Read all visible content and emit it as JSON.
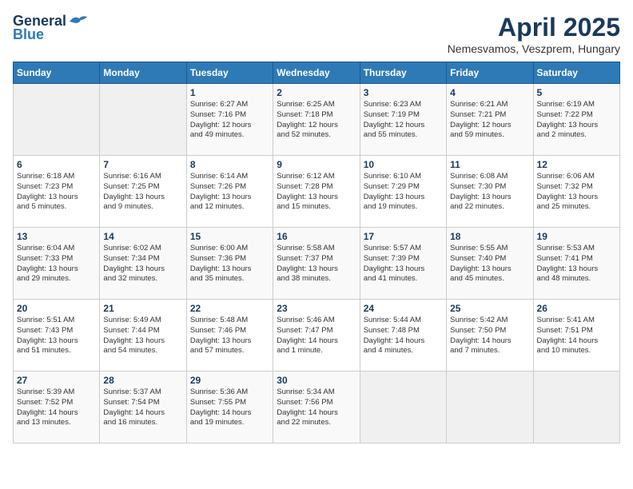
{
  "logo": {
    "general": "General",
    "blue": "Blue"
  },
  "title": "April 2025",
  "location": "Nemesvamos, Veszprem, Hungary",
  "days_header": [
    "Sunday",
    "Monday",
    "Tuesday",
    "Wednesday",
    "Thursday",
    "Friday",
    "Saturday"
  ],
  "weeks": [
    [
      {
        "num": "",
        "info": ""
      },
      {
        "num": "",
        "info": ""
      },
      {
        "num": "1",
        "info": "Sunrise: 6:27 AM\nSunset: 7:16 PM\nDaylight: 12 hours\nand 49 minutes."
      },
      {
        "num": "2",
        "info": "Sunrise: 6:25 AM\nSunset: 7:18 PM\nDaylight: 12 hours\nand 52 minutes."
      },
      {
        "num": "3",
        "info": "Sunrise: 6:23 AM\nSunset: 7:19 PM\nDaylight: 12 hours\nand 55 minutes."
      },
      {
        "num": "4",
        "info": "Sunrise: 6:21 AM\nSunset: 7:21 PM\nDaylight: 12 hours\nand 59 minutes."
      },
      {
        "num": "5",
        "info": "Sunrise: 6:19 AM\nSunset: 7:22 PM\nDaylight: 13 hours\nand 2 minutes."
      }
    ],
    [
      {
        "num": "6",
        "info": "Sunrise: 6:18 AM\nSunset: 7:23 PM\nDaylight: 13 hours\nand 5 minutes."
      },
      {
        "num": "7",
        "info": "Sunrise: 6:16 AM\nSunset: 7:25 PM\nDaylight: 13 hours\nand 9 minutes."
      },
      {
        "num": "8",
        "info": "Sunrise: 6:14 AM\nSunset: 7:26 PM\nDaylight: 13 hours\nand 12 minutes."
      },
      {
        "num": "9",
        "info": "Sunrise: 6:12 AM\nSunset: 7:28 PM\nDaylight: 13 hours\nand 15 minutes."
      },
      {
        "num": "10",
        "info": "Sunrise: 6:10 AM\nSunset: 7:29 PM\nDaylight: 13 hours\nand 19 minutes."
      },
      {
        "num": "11",
        "info": "Sunrise: 6:08 AM\nSunset: 7:30 PM\nDaylight: 13 hours\nand 22 minutes."
      },
      {
        "num": "12",
        "info": "Sunrise: 6:06 AM\nSunset: 7:32 PM\nDaylight: 13 hours\nand 25 minutes."
      }
    ],
    [
      {
        "num": "13",
        "info": "Sunrise: 6:04 AM\nSunset: 7:33 PM\nDaylight: 13 hours\nand 29 minutes."
      },
      {
        "num": "14",
        "info": "Sunrise: 6:02 AM\nSunset: 7:34 PM\nDaylight: 13 hours\nand 32 minutes."
      },
      {
        "num": "15",
        "info": "Sunrise: 6:00 AM\nSunset: 7:36 PM\nDaylight: 13 hours\nand 35 minutes."
      },
      {
        "num": "16",
        "info": "Sunrise: 5:58 AM\nSunset: 7:37 PM\nDaylight: 13 hours\nand 38 minutes."
      },
      {
        "num": "17",
        "info": "Sunrise: 5:57 AM\nSunset: 7:39 PM\nDaylight: 13 hours\nand 41 minutes."
      },
      {
        "num": "18",
        "info": "Sunrise: 5:55 AM\nSunset: 7:40 PM\nDaylight: 13 hours\nand 45 minutes."
      },
      {
        "num": "19",
        "info": "Sunrise: 5:53 AM\nSunset: 7:41 PM\nDaylight: 13 hours\nand 48 minutes."
      }
    ],
    [
      {
        "num": "20",
        "info": "Sunrise: 5:51 AM\nSunset: 7:43 PM\nDaylight: 13 hours\nand 51 minutes."
      },
      {
        "num": "21",
        "info": "Sunrise: 5:49 AM\nSunset: 7:44 PM\nDaylight: 13 hours\nand 54 minutes."
      },
      {
        "num": "22",
        "info": "Sunrise: 5:48 AM\nSunset: 7:46 PM\nDaylight: 13 hours\nand 57 minutes."
      },
      {
        "num": "23",
        "info": "Sunrise: 5:46 AM\nSunset: 7:47 PM\nDaylight: 14 hours\nand 1 minute."
      },
      {
        "num": "24",
        "info": "Sunrise: 5:44 AM\nSunset: 7:48 PM\nDaylight: 14 hours\nand 4 minutes."
      },
      {
        "num": "25",
        "info": "Sunrise: 5:42 AM\nSunset: 7:50 PM\nDaylight: 14 hours\nand 7 minutes."
      },
      {
        "num": "26",
        "info": "Sunrise: 5:41 AM\nSunset: 7:51 PM\nDaylight: 14 hours\nand 10 minutes."
      }
    ],
    [
      {
        "num": "27",
        "info": "Sunrise: 5:39 AM\nSunset: 7:52 PM\nDaylight: 14 hours\nand 13 minutes."
      },
      {
        "num": "28",
        "info": "Sunrise: 5:37 AM\nSunset: 7:54 PM\nDaylight: 14 hours\nand 16 minutes."
      },
      {
        "num": "29",
        "info": "Sunrise: 5:36 AM\nSunset: 7:55 PM\nDaylight: 14 hours\nand 19 minutes."
      },
      {
        "num": "30",
        "info": "Sunrise: 5:34 AM\nSunset: 7:56 PM\nDaylight: 14 hours\nand 22 minutes."
      },
      {
        "num": "",
        "info": ""
      },
      {
        "num": "",
        "info": ""
      },
      {
        "num": "",
        "info": ""
      }
    ]
  ]
}
